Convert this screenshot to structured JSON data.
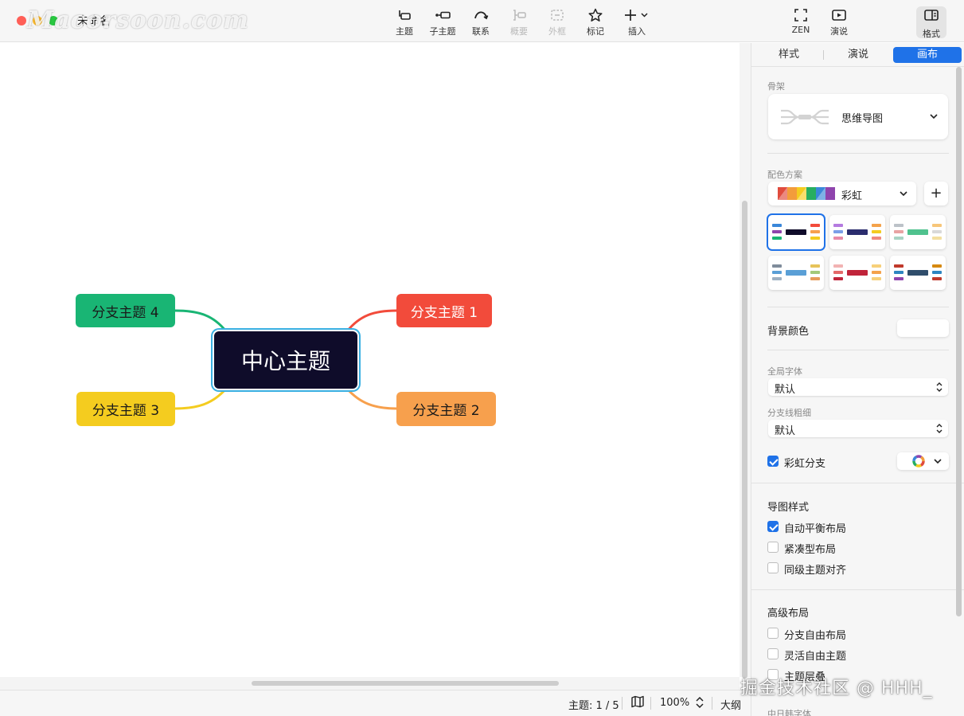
{
  "window": {
    "title": "未命名",
    "watermark": "Macorsoon.com"
  },
  "toolbar": {
    "topic": "主题",
    "subtopic": "子主题",
    "relation": "联系",
    "summary": "概要",
    "boundary": "外框",
    "marker": "标记",
    "insert": "插入",
    "zen": "ZEN",
    "present": "演说",
    "format": "格式"
  },
  "mindmap": {
    "center": "中心主题",
    "branches": [
      {
        "label": "分支主题 1",
        "color": "#f24b3b"
      },
      {
        "label": "分支主题 2",
        "color": "#f7a04d"
      },
      {
        "label": "分支主题 3",
        "color": "#f4cc1f"
      },
      {
        "label": "分支主题 4",
        "color": "#19b574"
      }
    ],
    "center_color": "#0f0c2a",
    "selection_color": "#3ab0e2"
  },
  "statusbar": {
    "topic_count": "主题: 1 / 5",
    "zoom": "100%",
    "outline": "大纲"
  },
  "panel": {
    "tabs": [
      "样式",
      "演说",
      "画布"
    ],
    "active_tab": "画布",
    "skeleton_label": "骨架",
    "skeleton_value": "思维导图",
    "color_scheme_label": "配色方案",
    "color_scheme_value": "彩虹",
    "add_button": "+",
    "background_color_label": "背景颜色",
    "global_font_label": "全局字体",
    "global_font_value": "默认",
    "branch_width_label": "分支线粗细",
    "branch_width_value": "默认",
    "rainbow_branch_label": "彩虹分支",
    "rainbow_branch_checked": true,
    "map_style_title": "导图样式",
    "map_style_options": [
      {
        "label": "自动平衡布局",
        "checked": true
      },
      {
        "label": "紧凑型布局",
        "checked": false
      },
      {
        "label": "同级主题对齐",
        "checked": false
      }
    ],
    "advanced_title": "高级布局",
    "advanced_options": [
      {
        "label": "分支自由布局",
        "checked": false
      },
      {
        "label": "灵活自由主题",
        "checked": false
      },
      {
        "label": "主题层叠",
        "checked": false
      }
    ],
    "cjk_font_label": "中日韩字体",
    "accent_color": "#1f72e8"
  },
  "footer_watermark": "掘金技术社区 @ HHH_"
}
